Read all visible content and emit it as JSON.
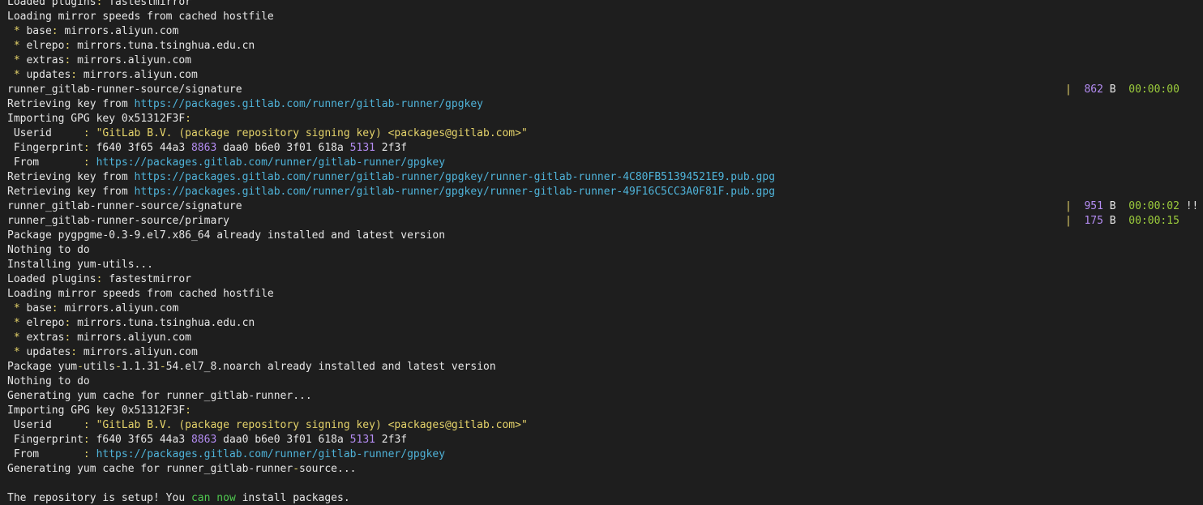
{
  "colors": {
    "background": "#1e1e1e",
    "default": "#e6e6e6",
    "yellow": "#e5d36a",
    "cyan": "#4fb3d9",
    "magenta": "#b48cf2",
    "green": "#9ccc3c",
    "bright": "#4fc84f"
  },
  "lines": [
    {
      "segs": [
        {
          "t": "Loaded plugins",
          "c": "default"
        },
        {
          "t": ":",
          "c": "yellow"
        },
        {
          "t": " fastestmirror",
          "c": "default"
        }
      ]
    },
    {
      "segs": [
        {
          "t": "Loading mirror speeds from cached hostfile",
          "c": "default"
        }
      ]
    },
    {
      "segs": [
        {
          "t": " * ",
          "c": "yellow"
        },
        {
          "t": "base",
          "c": "default"
        },
        {
          "t": ":",
          "c": "yellow"
        },
        {
          "t": " mirrors.aliyun.com",
          "c": "default"
        }
      ]
    },
    {
      "segs": [
        {
          "t": " * ",
          "c": "yellow"
        },
        {
          "t": "elrepo",
          "c": "default"
        },
        {
          "t": ":",
          "c": "yellow"
        },
        {
          "t": " mirrors.tuna.tsinghua.edu.cn",
          "c": "default"
        }
      ]
    },
    {
      "segs": [
        {
          "t": " * ",
          "c": "yellow"
        },
        {
          "t": "extras",
          "c": "default"
        },
        {
          "t": ":",
          "c": "yellow"
        },
        {
          "t": " mirrors.aliyun.com",
          "c": "default"
        }
      ]
    },
    {
      "segs": [
        {
          "t": " * ",
          "c": "yellow"
        },
        {
          "t": "updates",
          "c": "default"
        },
        {
          "t": ":",
          "c": "yellow"
        },
        {
          "t": " mirrors.aliyun.com",
          "c": "default"
        }
      ]
    },
    {
      "segs": [
        {
          "t": "runner_gitlab-runner-source/signature",
          "c": "default"
        }
      ],
      "right": [
        {
          "t": "|",
          "c": "yellow"
        },
        {
          "t": "  862",
          "c": "magenta"
        },
        {
          "t": " B  ",
          "c": "default"
        },
        {
          "t": "00:00:00",
          "c": "green"
        }
      ]
    },
    {
      "segs": [
        {
          "t": "Retrieving key from ",
          "c": "default"
        },
        {
          "t": "https://packages.gitlab.com/runner/gitlab-runner/gpgkey",
          "c": "cyan"
        }
      ]
    },
    {
      "segs": [
        {
          "t": "Importing GPG key 0x51312F3F",
          "c": "default"
        },
        {
          "t": ":",
          "c": "yellow"
        }
      ]
    },
    {
      "segs": [
        {
          "t": " Userid     ",
          "c": "default"
        },
        {
          "t": ": \"GitLab B.V. (package repository signing key) <packages@gitlab.com>\"",
          "c": "yellow"
        }
      ]
    },
    {
      "segs": [
        {
          "t": " Fingerprint",
          "c": "default"
        },
        {
          "t": ":",
          "c": "yellow"
        },
        {
          "t": " f640 3f65 44a3 ",
          "c": "default"
        },
        {
          "t": "8863",
          "c": "magenta"
        },
        {
          "t": " daa0 b6e0 3f01 618a ",
          "c": "default"
        },
        {
          "t": "5131",
          "c": "magenta"
        },
        {
          "t": " 2f3f",
          "c": "default"
        }
      ]
    },
    {
      "segs": [
        {
          "t": " From       ",
          "c": "default"
        },
        {
          "t": ": ",
          "c": "yellow"
        },
        {
          "t": "https://packages.gitlab.com/runner/gitlab-runner/gpgkey",
          "c": "cyan"
        }
      ]
    },
    {
      "segs": [
        {
          "t": "Retrieving key from ",
          "c": "default"
        },
        {
          "t": "https://packages.gitlab.com/runner/gitlab-runner/gpgkey/runner-gitlab-runner-4C80FB51394521E9.pub.gpg",
          "c": "cyan"
        }
      ]
    },
    {
      "segs": [
        {
          "t": "Retrieving key from ",
          "c": "default"
        },
        {
          "t": "https://packages.gitlab.com/runner/gitlab-runner/gpgkey/runner-gitlab-runner-49F16C5CC3A0F81F.pub.gpg",
          "c": "cyan"
        }
      ]
    },
    {
      "segs": [
        {
          "t": "runner_gitlab-runner-source/signature",
          "c": "default"
        }
      ],
      "right": [
        {
          "t": "|",
          "c": "yellow"
        },
        {
          "t": "  951",
          "c": "magenta"
        },
        {
          "t": " B  ",
          "c": "default"
        },
        {
          "t": "00:00:02",
          "c": "green"
        },
        {
          "t": " !!",
          "c": "default"
        }
      ]
    },
    {
      "segs": [
        {
          "t": "runner_gitlab-runner-source/primary",
          "c": "default"
        }
      ],
      "right": [
        {
          "t": "|",
          "c": "yellow"
        },
        {
          "t": "  175",
          "c": "magenta"
        },
        {
          "t": " B  ",
          "c": "default"
        },
        {
          "t": "00:00:15",
          "c": "green"
        }
      ]
    },
    {
      "segs": [
        {
          "t": "Package pygpgme-0.3-9.el7.x86_64 already installed and latest version",
          "c": "default"
        }
      ]
    },
    {
      "segs": [
        {
          "t": "Nothing to do",
          "c": "default"
        }
      ]
    },
    {
      "segs": [
        {
          "t": "Installing yum-utils...",
          "c": "default"
        }
      ]
    },
    {
      "segs": [
        {
          "t": "Loaded plugins",
          "c": "default"
        },
        {
          "t": ":",
          "c": "yellow"
        },
        {
          "t": " fastestmirror",
          "c": "default"
        }
      ]
    },
    {
      "segs": [
        {
          "t": "Loading mirror speeds from cached hostfile",
          "c": "default"
        }
      ]
    },
    {
      "segs": [
        {
          "t": " * ",
          "c": "yellow"
        },
        {
          "t": "base",
          "c": "default"
        },
        {
          "t": ":",
          "c": "yellow"
        },
        {
          "t": " mirrors.aliyun.com",
          "c": "default"
        }
      ]
    },
    {
      "segs": [
        {
          "t": " * ",
          "c": "yellow"
        },
        {
          "t": "elrepo",
          "c": "default"
        },
        {
          "t": ":",
          "c": "yellow"
        },
        {
          "t": " mirrors.tuna.tsinghua.edu.cn",
          "c": "default"
        }
      ]
    },
    {
      "segs": [
        {
          "t": " * ",
          "c": "yellow"
        },
        {
          "t": "extras",
          "c": "default"
        },
        {
          "t": ":",
          "c": "yellow"
        },
        {
          "t": " mirrors.aliyun.com",
          "c": "default"
        }
      ]
    },
    {
      "segs": [
        {
          "t": " * ",
          "c": "yellow"
        },
        {
          "t": "updates",
          "c": "default"
        },
        {
          "t": ":",
          "c": "yellow"
        },
        {
          "t": " mirrors.aliyun.com",
          "c": "default"
        }
      ]
    },
    {
      "segs": [
        {
          "t": "Package yum",
          "c": "default"
        },
        {
          "t": "-",
          "c": "yellow"
        },
        {
          "t": "utils",
          "c": "default"
        },
        {
          "t": "-",
          "c": "yellow"
        },
        {
          "t": "1.1.31",
          "c": "default"
        },
        {
          "t": "-",
          "c": "yellow"
        },
        {
          "t": "54.el7_8.noarch already installed and latest version",
          "c": "default"
        }
      ]
    },
    {
      "segs": [
        {
          "t": "Nothing to do",
          "c": "default"
        }
      ]
    },
    {
      "segs": [
        {
          "t": "Generating yum cache for runner_gitlab-runner...",
          "c": "default"
        }
      ]
    },
    {
      "segs": [
        {
          "t": "Importing GPG key 0x51312F3F",
          "c": "default"
        },
        {
          "t": ":",
          "c": "yellow"
        }
      ]
    },
    {
      "segs": [
        {
          "t": " Userid     ",
          "c": "default"
        },
        {
          "t": ": \"GitLab B.V. (package repository signing key) <packages@gitlab.com>\"",
          "c": "yellow"
        }
      ]
    },
    {
      "segs": [
        {
          "t": " Fingerprint",
          "c": "default"
        },
        {
          "t": ":",
          "c": "yellow"
        },
        {
          "t": " f640 3f65 44a3 ",
          "c": "default"
        },
        {
          "t": "8863",
          "c": "magenta"
        },
        {
          "t": " daa0 b6e0 3f01 618a ",
          "c": "default"
        },
        {
          "t": "5131",
          "c": "magenta"
        },
        {
          "t": " 2f3f",
          "c": "default"
        }
      ]
    },
    {
      "segs": [
        {
          "t": " From       ",
          "c": "default"
        },
        {
          "t": ": ",
          "c": "yellow"
        },
        {
          "t": "https://packages.gitlab.com/runner/gitlab-runner/gpgkey",
          "c": "cyan"
        }
      ]
    },
    {
      "segs": [
        {
          "t": "Generating yum cache for runner_gitlab-runner",
          "c": "default"
        },
        {
          "t": "-",
          "c": "yellow"
        },
        {
          "t": "source...",
          "c": "default"
        }
      ]
    },
    {
      "segs": [
        {
          "t": "",
          "c": "default"
        }
      ]
    },
    {
      "segs": [
        {
          "t": "The repository is setup! You ",
          "c": "default"
        },
        {
          "t": "can now",
          "c": "bright"
        },
        {
          "t": " install packages.",
          "c": "default"
        }
      ]
    }
  ]
}
